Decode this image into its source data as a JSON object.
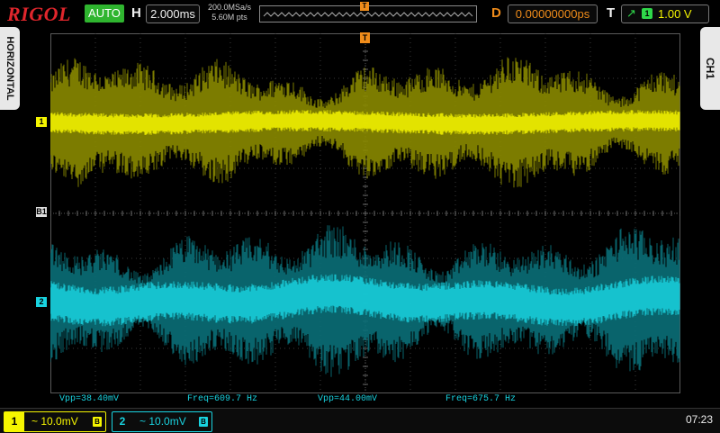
{
  "topbar": {
    "brand": "RIGOL",
    "run_status": "AUTO",
    "horizontal_letter": "H",
    "timebase": "2.000ms",
    "sample_rate": "200.0MSa/s",
    "memory_depth": "5.60M pts",
    "delay_letter": "D",
    "delay": "0.00000000ps",
    "trigger_letter": "T",
    "trigger_source": "1",
    "trigger_level": "1.00 V",
    "trigger_marker": "T"
  },
  "side_tabs": {
    "left": "HORIZONTAL",
    "right": "CH1"
  },
  "screen": {
    "ch1_marker": "1",
    "ch2_marker": "2",
    "ref_marker": "B1",
    "trigger_pos_marker": "T"
  },
  "measurements": [
    {
      "label": "Vpp=38.40mV"
    },
    {
      "label": "Freq=609.7 Hz"
    },
    {
      "label": "Vpp=44.00mV"
    },
    {
      "label": "Freq=675.7 Hz"
    }
  ],
  "bottombar": {
    "ch1": {
      "num": "1",
      "scale": "~ 10.0mV",
      "bw_icon": "B"
    },
    "ch2": {
      "num": "2",
      "scale": "~ 10.0mV",
      "bw_icon": "B"
    },
    "clock": "07:23"
  },
  "colors": {
    "ch1": "#f5f500",
    "ch1_dim": "#8a8a00",
    "ch2": "#19d3e0",
    "ch2_dim": "#0a6f78",
    "brand": "#e0262c",
    "trigger": "#f08c1a",
    "auto": "#2fb52f"
  }
}
